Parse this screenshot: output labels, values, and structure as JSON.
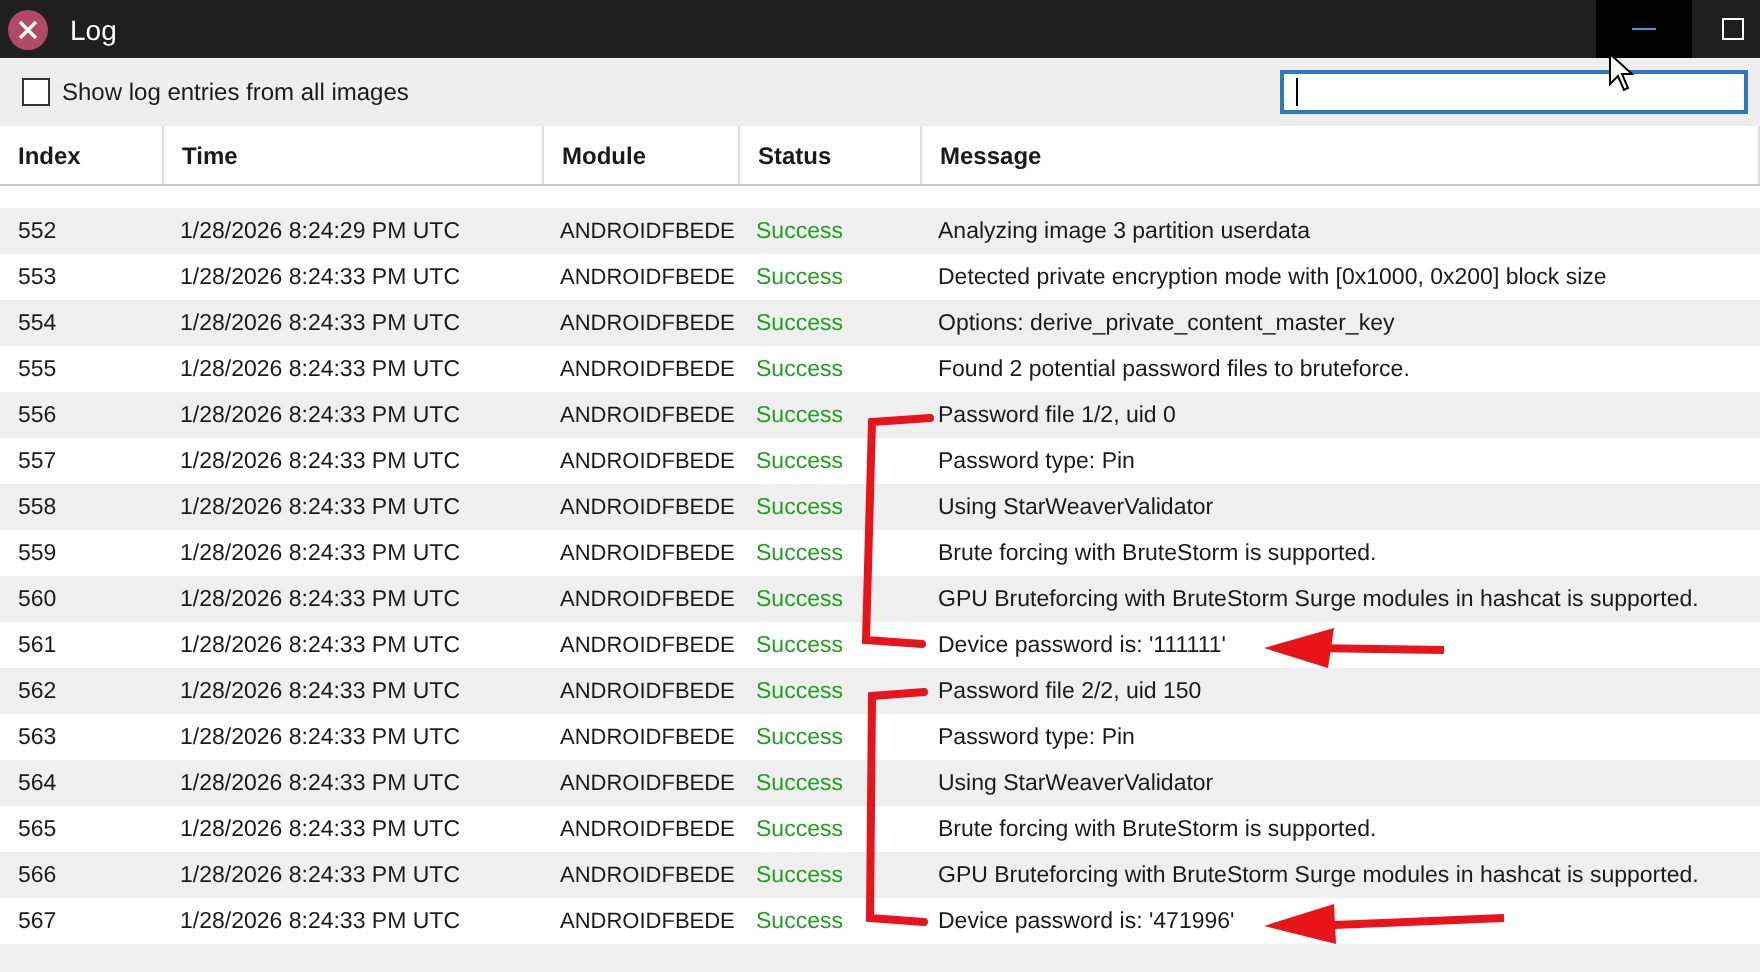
{
  "window": {
    "title": "Log"
  },
  "toolbar": {
    "checkbox": {
      "label": "Show log entries from all images",
      "checked": false
    }
  },
  "table": {
    "columns": [
      "Index",
      "Time",
      "Module",
      "Status",
      "Message"
    ],
    "rows": [
      {
        "index": "552",
        "time": "1/28/2026 8:24:29 PM UTC",
        "module": "ANDROIDFBEDE",
        "status": "Success",
        "kind": "success",
        "message": "Analyzing image 3 partition userdata"
      },
      {
        "index": "553",
        "time": "1/28/2026 8:24:33 PM UTC",
        "module": "ANDROIDFBEDE",
        "status": "Success",
        "kind": "success",
        "message": "Detected private encryption mode with [0x1000, 0x200] block size"
      },
      {
        "index": "554",
        "time": "1/28/2026 8:24:33 PM UTC",
        "module": "ANDROIDFBEDE",
        "status": "Success",
        "kind": "success",
        "message": "Options: derive_private_content_master_key"
      },
      {
        "index": "555",
        "time": "1/28/2026 8:24:33 PM UTC",
        "module": "ANDROIDFBEDE",
        "status": "Success",
        "kind": "success",
        "message": "Found 2 potential password files to bruteforce."
      },
      {
        "index": "556",
        "time": "1/28/2026 8:24:33 PM UTC",
        "module": "ANDROIDFBEDE",
        "status": "Success",
        "kind": "success",
        "message": "Password file 1/2, uid 0"
      },
      {
        "index": "557",
        "time": "1/28/2026 8:24:33 PM UTC",
        "module": "ANDROIDFBEDE",
        "status": "Success",
        "kind": "success",
        "message": "Password type: Pin"
      },
      {
        "index": "558",
        "time": "1/28/2026 8:24:33 PM UTC",
        "module": "ANDROIDFBEDE",
        "status": "Success",
        "kind": "success",
        "message": "Using StarWeaverValidator"
      },
      {
        "index": "559",
        "time": "1/28/2026 8:24:33 PM UTC",
        "module": "ANDROIDFBEDE",
        "status": "Success",
        "kind": "success",
        "message": "Brute forcing with BruteStorm is supported."
      },
      {
        "index": "560",
        "time": "1/28/2026 8:24:33 PM UTC",
        "module": "ANDROIDFBEDE",
        "status": "Success",
        "kind": "success",
        "message": "GPU Bruteforcing with BruteStorm Surge modules in hashcat is supported."
      },
      {
        "index": "561",
        "time": "1/28/2026 8:24:33 PM UTC",
        "module": "ANDROIDFBEDE",
        "status": "Success",
        "kind": "success",
        "message": "Device password is: '111111'"
      },
      {
        "index": "562",
        "time": "1/28/2026 8:24:33 PM UTC",
        "module": "ANDROIDFBEDE",
        "status": "Success",
        "kind": "success",
        "message": "Password file 2/2, uid 150"
      },
      {
        "index": "563",
        "time": "1/28/2026 8:24:33 PM UTC",
        "module": "ANDROIDFBEDE",
        "status": "Success",
        "kind": "success",
        "message": "Password type: Pin"
      },
      {
        "index": "564",
        "time": "1/28/2026 8:24:33 PM UTC",
        "module": "ANDROIDFBEDE",
        "status": "Success",
        "kind": "success",
        "message": "Using StarWeaverValidator"
      },
      {
        "index": "565",
        "time": "1/28/2026 8:24:33 PM UTC",
        "module": "ANDROIDFBEDE",
        "status": "Success",
        "kind": "success",
        "message": "Brute forcing with BruteStorm is supported."
      },
      {
        "index": "566",
        "time": "1/28/2026 8:24:33 PM UTC",
        "module": "ANDROIDFBEDE",
        "status": "Success",
        "kind": "success",
        "message": "GPU Bruteforcing with BruteStorm Surge modules in hashcat is supported."
      },
      {
        "index": "567",
        "time": "1/28/2026 8:24:33 PM UTC",
        "module": "ANDROIDFBEDE",
        "status": "Success",
        "kind": "success",
        "message": "Device password is: '471996'"
      }
    ]
  }
}
